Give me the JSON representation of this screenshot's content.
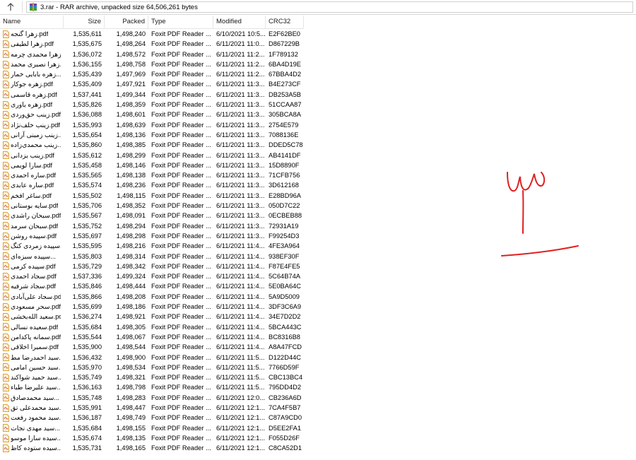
{
  "toolbar": {
    "path": "3.rar - RAR archive, unpacked size 64,506,261 bytes",
    "up_icon": "arrow-up-icon",
    "archive_icon": "rar-archive-icon"
  },
  "columns": {
    "name": "Name",
    "size": "Size",
    "packed": "Packed",
    "type": "Type",
    "modified": "Modified",
    "crc": "CRC32"
  },
  "colors": {
    "annotation": "#e02020",
    "pdf_icon": "#d9a23a"
  },
  "files": [
    {
      "name": "زهرا گنجه.pdf",
      "size": "1,535,611",
      "packed": "1,498,240",
      "type": "Foxit PDF Reader ...",
      "modified": "6/10/2021 10:5...",
      "crc": "E2F62BE0"
    },
    {
      "name": "زهرا لطیفی.pdf",
      "size": "1,535,675",
      "packed": "1,498,264",
      "type": "Foxit PDF Reader ...",
      "modified": "6/11/2021 11:0...",
      "crc": "D867229B"
    },
    {
      "name": "زهرا محمدی چرمه...",
      "size": "1,536,072",
      "packed": "1,498,572",
      "type": "Foxit PDF Reader ...",
      "modified": "6/11/2021 11:2...",
      "crc": "1F789132"
    },
    {
      "name": "زهرا نصیری محمد...",
      "size": "1,536,155",
      "packed": "1,498,758",
      "type": "Foxit PDF Reader ...",
      "modified": "6/11/2021 11:2...",
      "crc": "6BA4D19E"
    },
    {
      "name": "زهره بابایی خمار...",
      "size": "1,535,439",
      "packed": "1,497,969",
      "type": "Foxit PDF Reader ...",
      "modified": "6/11/2021 11:2...",
      "crc": "67BBA4D2"
    },
    {
      "name": "زهره جوکار.pdf",
      "size": "1,535,409",
      "packed": "1,497,921",
      "type": "Foxit PDF Reader ...",
      "modified": "6/11/2021 11:3...",
      "crc": "B4E273CF"
    },
    {
      "name": "زهره قاسمی.pdf",
      "size": "1,537,441",
      "packed": "1,499,344",
      "type": "Foxit PDF Reader ...",
      "modified": "6/11/2021 11:3...",
      "crc": "DB253A5B"
    },
    {
      "name": "زهره یاوری.pdf",
      "size": "1,535,826",
      "packed": "1,498,359",
      "type": "Foxit PDF Reader ...",
      "modified": "6/11/2021 11:3...",
      "crc": "51CCAA87"
    },
    {
      "name": "زینب حق‌وردی.pdf",
      "size": "1,536,088",
      "packed": "1,498,601",
      "type": "Foxit PDF Reader ...",
      "modified": "6/11/2021 11:3...",
      "crc": "305BCA8A"
    },
    {
      "name": "زینب خلف‌نژاد.pdf",
      "size": "1,535,993",
      "packed": "1,498,639",
      "type": "Foxit PDF Reader ...",
      "modified": "6/11/2021 11:3...",
      "crc": "2754E579"
    },
    {
      "name": "زینب زمینی آرانی...",
      "size": "1,535,654",
      "packed": "1,498,136",
      "type": "Foxit PDF Reader ...",
      "modified": "6/11/2021 11:3...",
      "crc": "7088136E"
    },
    {
      "name": "زینب محمدی‌زاده...",
      "size": "1,535,860",
      "packed": "1,498,385",
      "type": "Foxit PDF Reader ...",
      "modified": "6/11/2021 11:3...",
      "crc": "DDED5C78"
    },
    {
      "name": "زینب یزدانی.pdf",
      "size": "1,535,612",
      "packed": "1,498,299",
      "type": "Foxit PDF Reader ...",
      "modified": "6/11/2021 11:3...",
      "crc": "AB4141DF"
    },
    {
      "name": "سارا لویمی.pdf",
      "size": "1,535,458",
      "packed": "1,498,146",
      "type": "Foxit PDF Reader ...",
      "modified": "6/11/2021 11:3...",
      "crc": "15D8890F"
    },
    {
      "name": "ساره احمدی.pdf",
      "size": "1,535,565",
      "packed": "1,498,138",
      "type": "Foxit PDF Reader ...",
      "modified": "6/11/2021 11:3...",
      "crc": "71CFB756"
    },
    {
      "name": "ساره عابدی.pdf",
      "size": "1,535,574",
      "packed": "1,498,236",
      "type": "Foxit PDF Reader ...",
      "modified": "6/11/2021 11:3...",
      "crc": "3D612168"
    },
    {
      "name": "ساغر افخم.pdf",
      "size": "1,535,502",
      "packed": "1,498,115",
      "type": "Foxit PDF Reader ...",
      "modified": "6/11/2021 11:3...",
      "crc": "E28BD96A"
    },
    {
      "name": "سایه بوستانی.pdf",
      "size": "1,535,706",
      "packed": "1,498,352",
      "type": "Foxit PDF Reader ...",
      "modified": "6/11/2021 11:3...",
      "crc": "050D7C22"
    },
    {
      "name": "سبحان راشدی.pdf",
      "size": "1,535,567",
      "packed": "1,498,091",
      "type": "Foxit PDF Reader ...",
      "modified": "6/11/2021 11:3...",
      "crc": "0ECBEB88"
    },
    {
      "name": "سبحان سرمد.pdf",
      "size": "1,535,752",
      "packed": "1,498,294",
      "type": "Foxit PDF Reader ...",
      "modified": "6/11/2021 11:3...",
      "crc": "72931A19"
    },
    {
      "name": "سپیده روشن.pdf",
      "size": "1,535,697",
      "packed": "1,498,298",
      "type": "Foxit PDF Reader ...",
      "modified": "6/11/2021 11:3...",
      "crc": "F99254D3"
    },
    {
      "name": "سپیده زمردی کنگ...",
      "size": "1,535,595",
      "packed": "1,498,216",
      "type": "Foxit PDF Reader ...",
      "modified": "6/11/2021 11:4...",
      "crc": "4FE3A964"
    },
    {
      "name": "سپیده سبزه‌ای...",
      "size": "1,535,803",
      "packed": "1,498,314",
      "type": "Foxit PDF Reader ...",
      "modified": "6/11/2021 11:4...",
      "crc": "938EF30F"
    },
    {
      "name": "سپیده کرمی.pdf",
      "size": "1,535,729",
      "packed": "1,498,342",
      "type": "Foxit PDF Reader ...",
      "modified": "6/11/2021 11:4...",
      "crc": "F87E4FE5"
    },
    {
      "name": "سجاد احمدی.pdf",
      "size": "1,537,336",
      "packed": "1,499,324",
      "type": "Foxit PDF Reader ...",
      "modified": "6/11/2021 11:4...",
      "crc": "5C64B74A"
    },
    {
      "name": "سجاد شرفیه.pdf",
      "size": "1,535,846",
      "packed": "1,498,444",
      "type": "Foxit PDF Reader ...",
      "modified": "6/11/2021 11:4...",
      "crc": "5E0BA64C"
    },
    {
      "name": "سجاد علی‌آبادی.pdf",
      "size": "1,535,866",
      "packed": "1,498,208",
      "type": "Foxit PDF Reader ...",
      "modified": "6/11/2021 11:4...",
      "crc": "5A9D5009"
    },
    {
      "name": "سحر مسعودی.pdf",
      "size": "1,535,699",
      "packed": "1,498,186",
      "type": "Foxit PDF Reader ...",
      "modified": "6/11/2021 11:4...",
      "crc": "3DF3C6A9"
    },
    {
      "name": "سعید الله‌بخشی.pdf",
      "size": "1,536,274",
      "packed": "1,498,921",
      "type": "Foxit PDF Reader ...",
      "modified": "6/11/2021 11:4...",
      "crc": "34E7D2D2"
    },
    {
      "name": "سعیده نسالی.pdf",
      "size": "1,535,684",
      "packed": "1,498,305",
      "type": "Foxit PDF Reader ...",
      "modified": "6/11/2021 11:4...",
      "crc": "5BCA443C"
    },
    {
      "name": "سمانه پاکدامن.pdf",
      "size": "1,535,544",
      "packed": "1,498,067",
      "type": "Foxit PDF Reader ...",
      "modified": "6/11/2021 11:4...",
      "crc": "BC8316B8"
    },
    {
      "name": "سمیرا اخلاقی.pdf",
      "size": "1,535,900",
      "packed": "1,498,544",
      "type": "Foxit PDF Reader ...",
      "modified": "6/11/2021 11:4...",
      "crc": "A8A47FCD"
    },
    {
      "name": "سید احمدرضا مط...",
      "size": "1,536,432",
      "packed": "1,498,900",
      "type": "Foxit PDF Reader ...",
      "modified": "6/11/2021 11:5...",
      "crc": "D122D44C"
    },
    {
      "name": "سید حسین امامی...",
      "size": "1,535,970",
      "packed": "1,498,534",
      "type": "Foxit PDF Reader ...",
      "modified": "6/11/2021 11:5...",
      "crc": "7766D59F"
    },
    {
      "name": "سید حمید شواکند...",
      "size": "1,535,749",
      "packed": "1,498,321",
      "type": "Foxit PDF Reader ...",
      "modified": "6/11/2021 11:5...",
      "crc": "CBC13BC4"
    },
    {
      "name": "سید علیرضا طباء...",
      "size": "1,536,163",
      "packed": "1,498,798",
      "type": "Foxit PDF Reader ...",
      "modified": "6/11/2021 11:5...",
      "crc": "795DD4D2"
    },
    {
      "name": "سید محمدصادق...",
      "size": "1,535,748",
      "packed": "1,498,283",
      "type": "Foxit PDF Reader ...",
      "modified": "6/11/2021 12:0...",
      "crc": "CB236A6D"
    },
    {
      "name": "سید محمدعلی تق...",
      "size": "1,535,991",
      "packed": "1,498,447",
      "type": "Foxit PDF Reader ...",
      "modified": "6/11/2021 12:1...",
      "crc": "7CA4F5B7"
    },
    {
      "name": "سید محمود رفعت...",
      "size": "1,536,187",
      "packed": "1,498,749",
      "type": "Foxit PDF Reader ...",
      "modified": "6/11/2021 12:1...",
      "crc": "C87A9CD0"
    },
    {
      "name": "سید مهدی نجات...",
      "size": "1,535,684",
      "packed": "1,498,155",
      "type": "Foxit PDF Reader ...",
      "modified": "6/11/2021 12:1...",
      "crc": "D5EE2FA1"
    },
    {
      "name": "سیده سارا موسو...",
      "size": "1,535,674",
      "packed": "1,498,135",
      "type": "Foxit PDF Reader ...",
      "modified": "6/11/2021 12:1...",
      "crc": "F055D26F"
    },
    {
      "name": "سیده ستوده کاظ...",
      "size": "1,535,731",
      "packed": "1,498,165",
      "type": "Foxit PDF Reader ...",
      "modified": "6/11/2021 12:1...",
      "crc": "C8CA52D1"
    }
  ]
}
